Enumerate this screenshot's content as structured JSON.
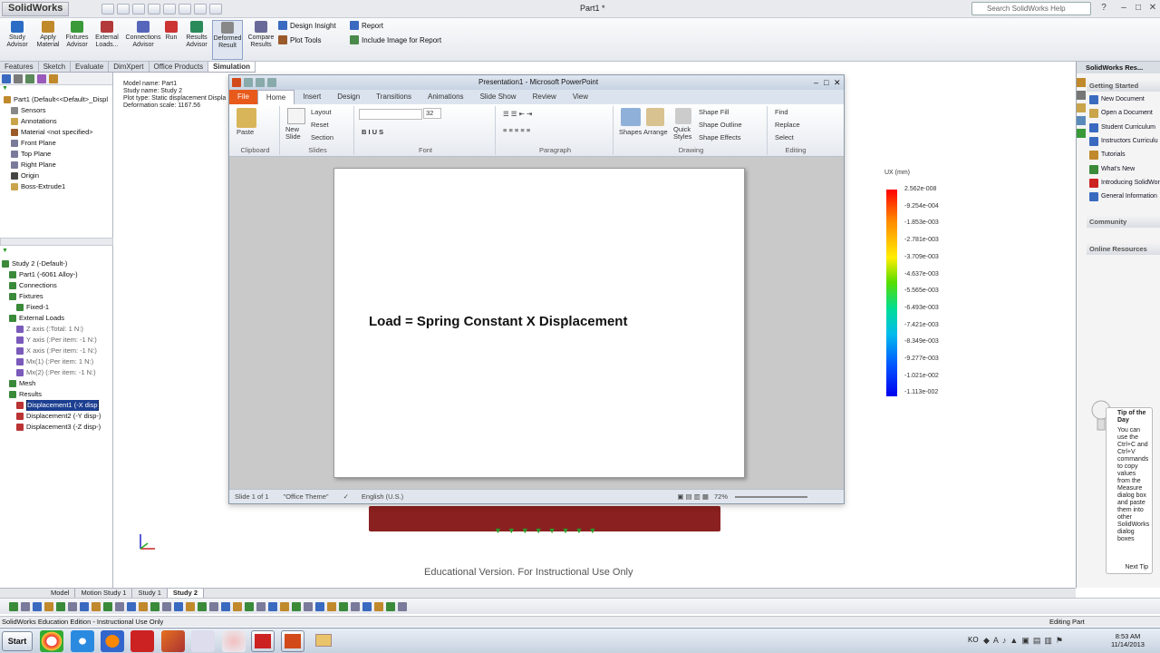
{
  "app": {
    "logo": "SolidWorks",
    "title": "Part1 *",
    "help_search_placeholder": "Search SolidWorks Help"
  },
  "command_manager": {
    "buttons": [
      {
        "label": "Study\nAdvisor",
        "icon": "study-advisor-icon"
      },
      {
        "label": "Apply\nMaterial",
        "icon": "apply-material-icon"
      },
      {
        "label": "Fixtures\nAdvisor",
        "icon": "fixtures-icon"
      },
      {
        "label": "External\nLoads...",
        "icon": "external-loads-icon"
      },
      {
        "label": "Connections\nAdvisor",
        "icon": "connections-icon"
      },
      {
        "label": "Run",
        "icon": "run-icon"
      },
      {
        "label": "Results\nAdvisor",
        "icon": "results-icon"
      },
      {
        "label": "Deformed\nResult",
        "icon": "deformed-result-icon"
      },
      {
        "label": "Compare\nResults",
        "icon": "compare-results-icon"
      }
    ],
    "small": [
      "Design Insight",
      "Plot Tools",
      "Report",
      "Include Image for Report"
    ]
  },
  "tabs": [
    "Features",
    "Sketch",
    "Evaluate",
    "DimXpert",
    "Office Products",
    "Simulation"
  ],
  "active_tab": "Simulation",
  "feature_tree": {
    "model_info": [
      "Model name: Part1",
      "Study name: Study 2",
      "Plot type: Static displacement Displa",
      "Deformation scale: 1167.56"
    ],
    "items": [
      "Part1  (Default<<Default>_Displ",
      "Sensors",
      "Annotations",
      "Material <not specified>",
      "Front Plane",
      "Top Plane",
      "Right Plane",
      "Origin",
      "Boss-Extrude1"
    ]
  },
  "study_tree": {
    "items": [
      "Study 2 (-Default-)",
      "Part1 (-6061 Alloy-)",
      "Connections",
      "Fixtures",
      "Fixed-1",
      "External Loads",
      "Z axis (:Total: 1 N:)",
      "Y axis (:Per item: -1 N:)",
      "X axis (:Per item: -1 N:)",
      "Mx(1) (:Per item: 1 N:)",
      "Mx(2) (:Per item: -1 N:)",
      "Mesh",
      "Results",
      "Displacement1 (-X disp",
      "Displacement2 (-Y disp-)",
      "Displacement3 (-Z disp-)"
    ]
  },
  "legend": {
    "title": "UX (mm)",
    "labels": [
      "2.562e-008",
      "-9.254e-004",
      "-1.853e-003",
      "-2.781e-003",
      "-3.709e-003",
      "-4.637e-003",
      "-5.565e-003",
      "-6.493e-003",
      "-7.421e-003",
      "-8.349e-003",
      "-9.277e-003",
      "-1.021e-002",
      "-1.113e-002"
    ]
  },
  "viewport": {
    "watermark": "Educational Version. For Instructional Use Only"
  },
  "powerpoint": {
    "title": "Presentation1 - Microsoft PowerPoint",
    "tabs": [
      "File",
      "Home",
      "Insert",
      "Design",
      "Transitions",
      "Animations",
      "Slide Show",
      "Review",
      "View"
    ],
    "active_tab": "Home",
    "ribbon": {
      "paste": "Paste",
      "new_slide": "New\nSlide",
      "layout": "Layout",
      "reset": "Reset",
      "section": "Section",
      "font_size": "32",
      "shapes": "Shapes",
      "arrange": "Arrange",
      "quick_styles": "Quick\nStyles",
      "shape_fill": "Shape Fill",
      "shape_outline": "Shape Outline",
      "shape_effects": "Shape Effects",
      "find": "Find",
      "replace": "Replace",
      "select": "Select",
      "groups": [
        "Clipboard",
        "Slides",
        "Font",
        "Paragraph",
        "Drawing",
        "Editing"
      ]
    },
    "slide_text": "Load = Spring Constant X Displacement",
    "status": {
      "slide": "Slide 1 of 1",
      "theme": "\"Office Theme\"",
      "language": "English (U.S.)",
      "zoom": "72%"
    }
  },
  "right_pane": {
    "title": "SolidWorks Res...",
    "getting_started": "Getting Started",
    "links": [
      "New Document",
      "Open a Document",
      "Student Curriculum",
      "Instructors Curriculu",
      "Tutorials",
      "What's New",
      "Introducing SolidWork",
      "General Information"
    ],
    "community": "Community",
    "online": "Online Resources",
    "tip_title": "Tip of the Day",
    "tip_text": "You can use the Ctrl+C and Ctrl+V commands to copy values from the Measure dialog box and paste them into other SolidWorks dialog boxes",
    "next_tip": "Next Tip"
  },
  "bottom_tabs": [
    "Model",
    "Motion Study 1",
    "Study 1",
    "Study 2"
  ],
  "active_bottom_tab": "Study 2",
  "status_bar": {
    "left": "SolidWorks Education Edition - Instructional Use Only",
    "right": "Editing Part"
  },
  "taskbar": {
    "start": "Start",
    "time": "8:53 AM",
    "date": "11/14/2013",
    "lang": "KO"
  }
}
